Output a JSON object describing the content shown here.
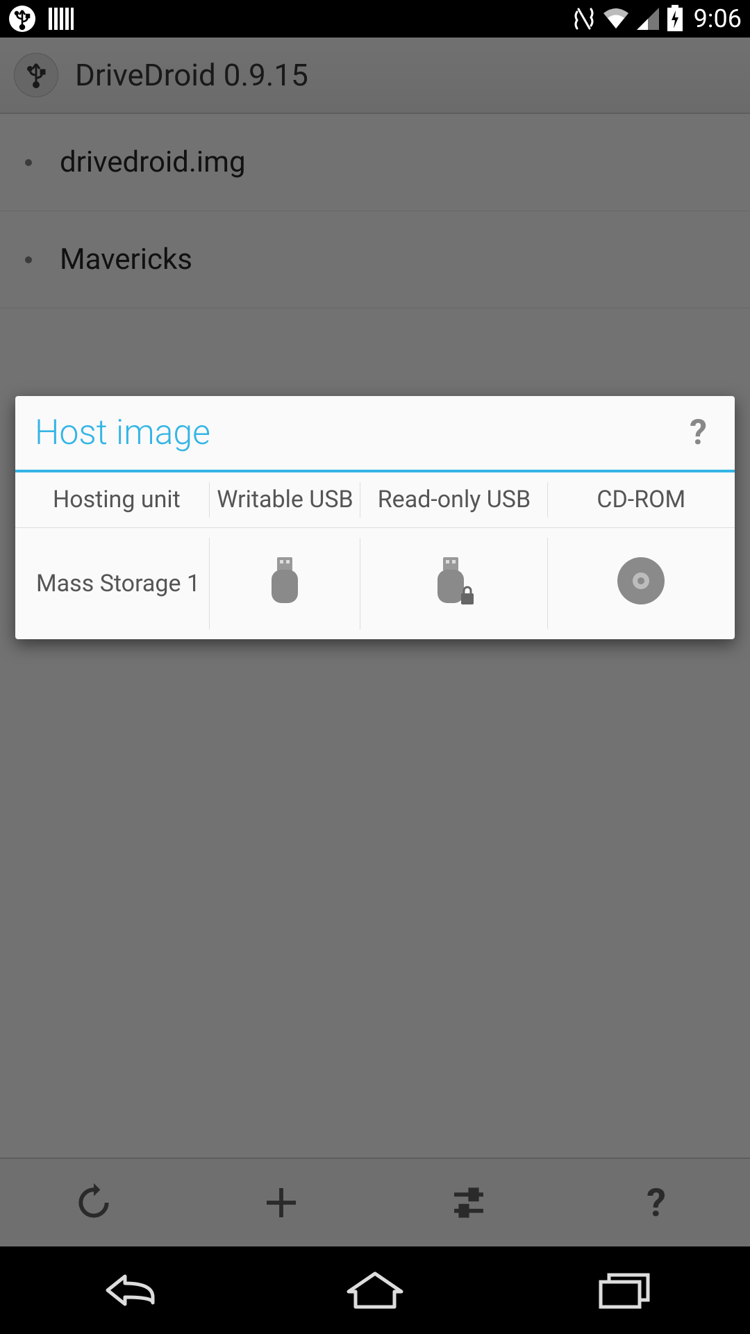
{
  "status": {
    "time": "9:06"
  },
  "header": {
    "title": "DriveDroid 0.9.15"
  },
  "list": {
    "items": [
      {
        "label": "drivedroid.img"
      },
      {
        "label": "Mavericks"
      }
    ]
  },
  "dialog": {
    "title": "Host image",
    "help": "?",
    "columns": {
      "hosting_unit": "Hosting unit",
      "writable_usb": "Writable USB",
      "readonly_usb": "Read-only USB",
      "cdrom": "CD-ROM"
    },
    "rows": [
      {
        "name": "Mass Storage 1"
      }
    ]
  },
  "actionbar": {
    "help": "?"
  }
}
